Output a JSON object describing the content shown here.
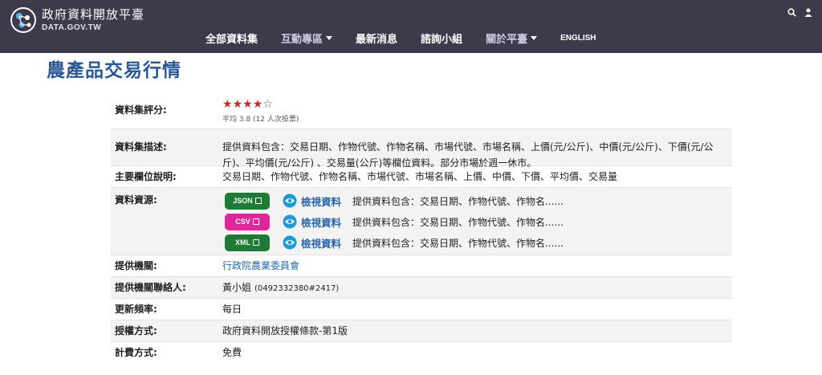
{
  "header": {
    "site_name_cn": "政府資料開放平臺",
    "site_name_en": "DATA.GOV.TW",
    "nav": [
      {
        "label": "全部資料集",
        "dropdown": false
      },
      {
        "label": "互動專區",
        "dropdown": true
      },
      {
        "label": "最新消息",
        "dropdown": false
      },
      {
        "label": "諮詢小組",
        "dropdown": false
      },
      {
        "label": "關於平臺",
        "dropdown": true
      },
      {
        "label": "ENGLISH",
        "dropdown": false
      }
    ]
  },
  "dataset": {
    "title": "農產品交易行情",
    "rating": {
      "label": "資料集評分:",
      "score": 3.8,
      "max": 5,
      "stars_filled": 4,
      "summary": "平均 3.8 (12 人次投票)"
    },
    "description": {
      "label": "資料集描述:",
      "text": "提供資料包含：交易日期、作物代號、作物名稱、市場代號、市場名稱、上價(元/公斤)、中價(元/公斤)、下價(元/公斤)、平均價(元/公斤) 、交易量(公斤)等欄位資料。部分市場於週一休市。"
    },
    "fields": {
      "label": "主要欄位說明:",
      "text": "交易日期、作物代號、作物名稱、市場代號、市場名稱、上價、中價、下價、平均價、交易量"
    },
    "resources": {
      "label": "資料資源:",
      "items": [
        {
          "format": "JSON",
          "color": "#1e7a34",
          "view_label": "檢視資料",
          "desc": "提供資料包含：交易日期、作物代號、作物名......"
        },
        {
          "format": "CSV",
          "color": "#e0269a",
          "view_label": "檢視資料",
          "desc": "提供資料包含：交易日期、作物代號、作物名......"
        },
        {
          "format": "XML",
          "color": "#1e7a34",
          "view_label": "檢視資料",
          "desc": "提供資料包含：交易日期、作物代號、作物名......"
        }
      ]
    },
    "provider": {
      "label": "提供機關:",
      "value": "行政院農業委員會"
    },
    "contact": {
      "label": "提供機關聯絡人:",
      "name": "黃小姐",
      "phone": "(0492332380#2417)"
    },
    "frequency": {
      "label": "更新頻率:",
      "value": "每日"
    },
    "license": {
      "label": "授權方式:",
      "value": "政府資料開放授權條款-第1版"
    },
    "fee": {
      "label": "計費方式:",
      "value": "免費"
    }
  },
  "colors": {
    "header_bg": "#3d3a4c",
    "title": "#2b5a93",
    "link": "#2b66a8",
    "star_on": "#c62828",
    "eye_icon": "#1e9ad6"
  }
}
